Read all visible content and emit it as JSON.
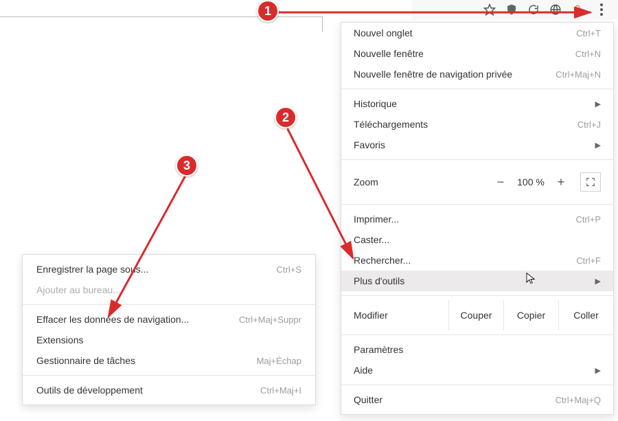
{
  "toolbar_icons": [
    "star-icon",
    "shield-icon",
    "refresh-icon",
    "globe-icon",
    "lock-icon"
  ],
  "menu": {
    "new_tab": {
      "label": "Nouvel onglet",
      "shortcut": "Ctrl+T"
    },
    "new_window": {
      "label": "Nouvelle fenêtre",
      "shortcut": "Ctrl+N"
    },
    "new_incognito": {
      "label": "Nouvelle fenêtre de navigation privée",
      "shortcut": "Ctrl+Maj+N"
    },
    "history": {
      "label": "Historique"
    },
    "downloads": {
      "label": "Téléchargements",
      "shortcut": "Ctrl+J"
    },
    "favorites": {
      "label": "Favoris"
    },
    "zoom": {
      "label": "Zoom",
      "minus": "−",
      "value": "100 %",
      "plus": "+"
    },
    "print": {
      "label": "Imprimer...",
      "shortcut": "Ctrl+P"
    },
    "cast": {
      "label": "Caster..."
    },
    "find": {
      "label": "Rechercher...",
      "shortcut": "Ctrl+F"
    },
    "more_tools": {
      "label": "Plus d'outils"
    },
    "modify": {
      "label": "Modifier",
      "cut": "Couper",
      "copy": "Copier",
      "paste": "Coller"
    },
    "settings": {
      "label": "Paramètres"
    },
    "help": {
      "label": "Aide"
    },
    "quit": {
      "label": "Quitter",
      "shortcut": "Ctrl+Maj+Q"
    }
  },
  "submenu": {
    "save_page": {
      "label": "Enregistrer la page sous...",
      "shortcut": "Ctrl+S"
    },
    "add_desktop": {
      "label": "Ajouter au bureau..."
    },
    "clear_data": {
      "label": "Effacer les données de navigation...",
      "shortcut": "Ctrl+Maj+Suppr"
    },
    "extensions": {
      "label": "Extensions"
    },
    "task_manager": {
      "label": "Gestionnaire de tâches",
      "shortcut": "Maj+Échap"
    },
    "dev_tools": {
      "label": "Outils de développement",
      "shortcut": "Ctrl+Maj+I"
    }
  },
  "annotations": {
    "one": "1",
    "two": "2",
    "three": "3"
  }
}
